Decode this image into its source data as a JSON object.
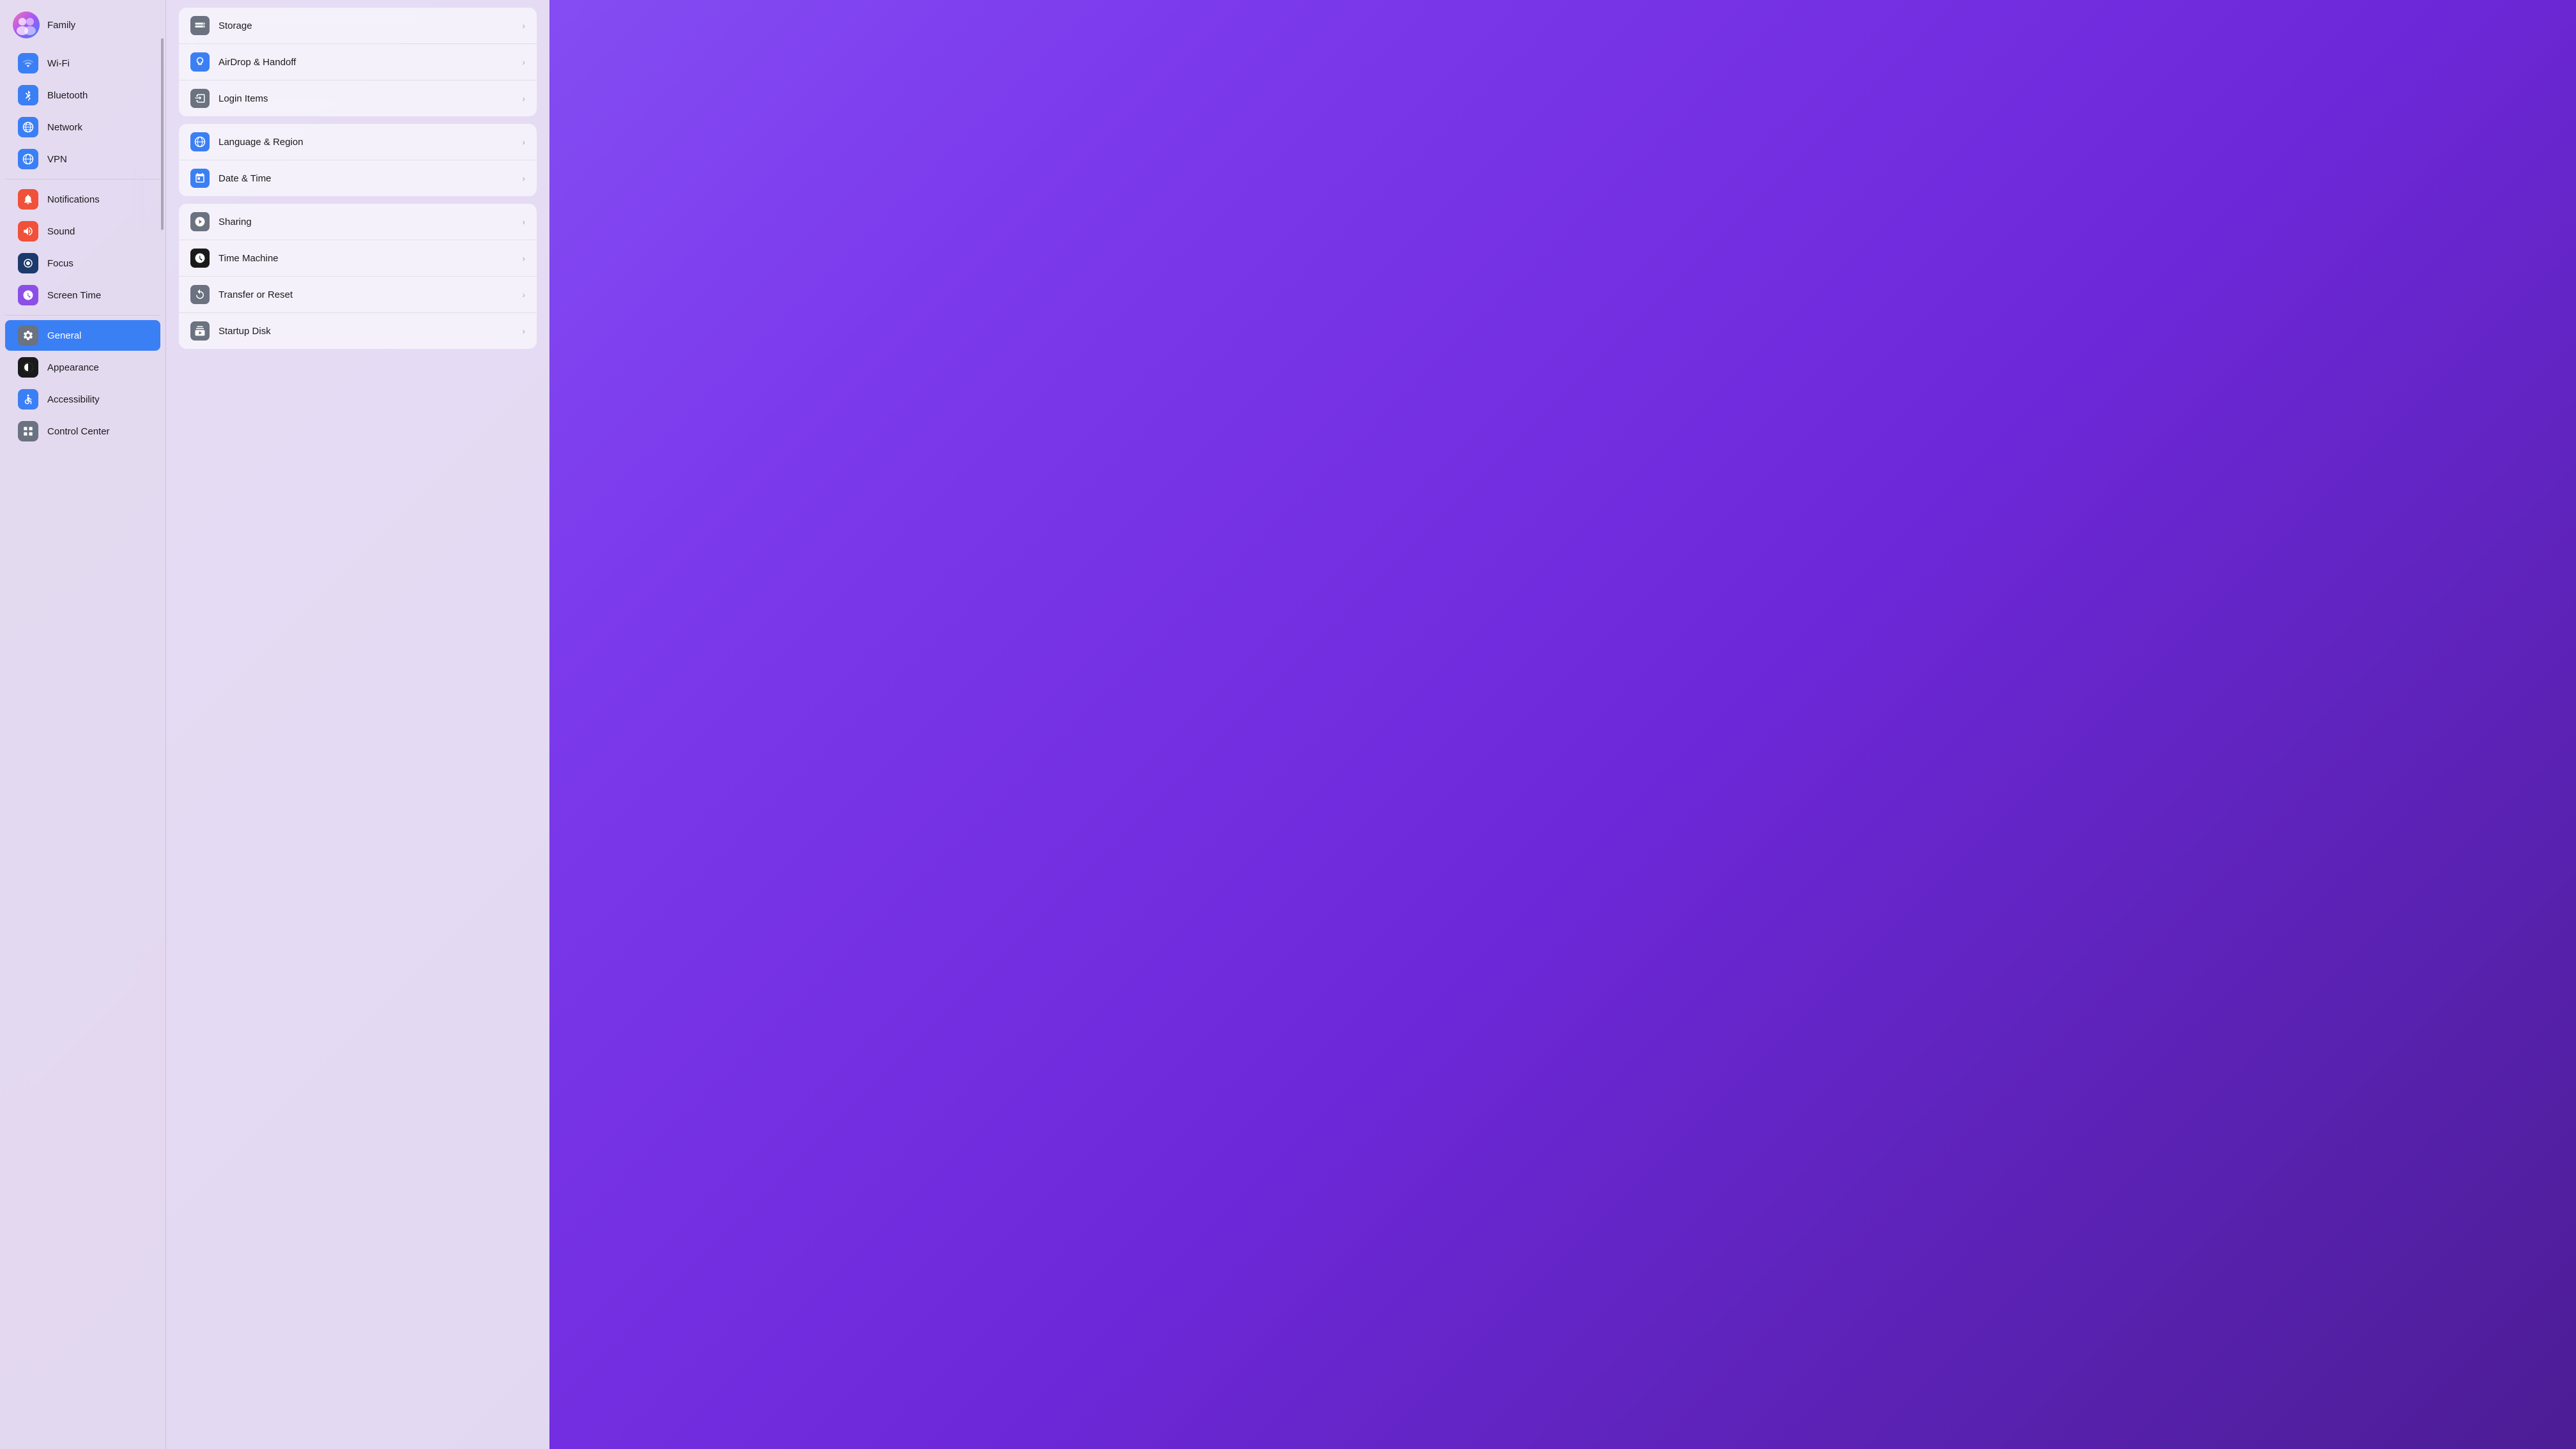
{
  "sidebar": {
    "family": {
      "label": "Family"
    },
    "items": [
      {
        "id": "wifi",
        "label": "Wi-Fi",
        "icon": "wifi",
        "iconColor": "#3B7FF5",
        "active": false
      },
      {
        "id": "bluetooth",
        "label": "Bluetooth",
        "icon": "bluetooth",
        "iconColor": "#3B7FF5",
        "active": false
      },
      {
        "id": "network",
        "label": "Network",
        "icon": "network",
        "iconColor": "#3B7FF5",
        "active": false
      },
      {
        "id": "vpn",
        "label": "VPN",
        "icon": "vpn",
        "iconColor": "#3B7FF5",
        "active": false
      },
      {
        "id": "notifications",
        "label": "Notifications",
        "icon": "notifications",
        "iconColor": "#F05138",
        "active": false
      },
      {
        "id": "sound",
        "label": "Sound",
        "icon": "sound",
        "iconColor": "#F05138",
        "active": false
      },
      {
        "id": "focus",
        "label": "Focus",
        "icon": "focus",
        "iconColor": "#1C3A6B",
        "active": false
      },
      {
        "id": "screen-time",
        "label": "Screen Time",
        "icon": "screen-time",
        "iconColor": "#8B4FE8",
        "active": false
      },
      {
        "id": "general",
        "label": "General",
        "icon": "general",
        "iconColor": "#6B7280",
        "active": true
      },
      {
        "id": "appearance",
        "label": "Appearance",
        "icon": "appearance",
        "iconColor": "#1a1a1a",
        "active": false
      },
      {
        "id": "accessibility",
        "label": "Accessibility",
        "icon": "accessibility",
        "iconColor": "#3B7FF5",
        "active": false
      },
      {
        "id": "control-center",
        "label": "Control Center",
        "icon": "control-center",
        "iconColor": "#6B7280",
        "active": false
      }
    ]
  },
  "main": {
    "groups": [
      {
        "id": "group1",
        "rows": [
          {
            "id": "storage",
            "label": "Storage",
            "iconClass": "ri-storage"
          },
          {
            "id": "airdrop",
            "label": "AirDrop & Handoff",
            "iconClass": "ri-airdrop"
          },
          {
            "id": "login",
            "label": "Login Items",
            "iconClass": "ri-login"
          }
        ]
      },
      {
        "id": "group2",
        "rows": [
          {
            "id": "language",
            "label": "Language & Region",
            "iconClass": "ri-language"
          },
          {
            "id": "datetime",
            "label": "Date & Time",
            "iconClass": "ri-datetime"
          }
        ]
      },
      {
        "id": "group3",
        "rows": [
          {
            "id": "sharing",
            "label": "Sharing",
            "iconClass": "ri-sharing"
          },
          {
            "id": "timemachine",
            "label": "Time Machine",
            "iconClass": "ri-timemachine"
          },
          {
            "id": "transfer",
            "label": "Transfer or Reset",
            "iconClass": "ri-transfer"
          },
          {
            "id": "startup",
            "label": "Startup Disk",
            "iconClass": "ri-startup"
          }
        ]
      }
    ]
  },
  "chevron": "›"
}
